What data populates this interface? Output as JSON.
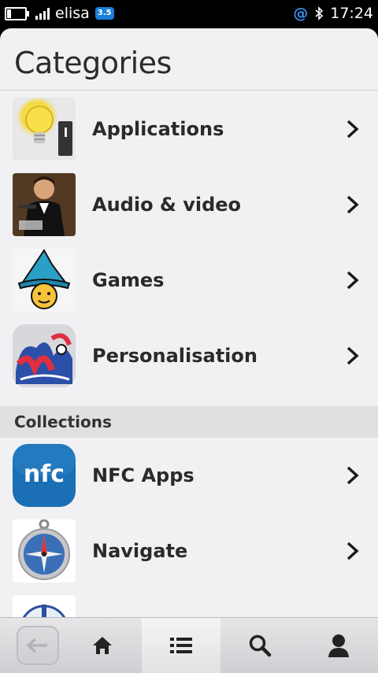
{
  "status_bar": {
    "carrier": "elisa",
    "network_badge": "3.5",
    "time": "17:24",
    "icons": [
      "battery-icon",
      "signal-icon",
      "at-icon",
      "bluetooth-icon"
    ]
  },
  "page": {
    "title": "Categories"
  },
  "categories": [
    {
      "label": "Applications",
      "icon": "lightbulb-icon"
    },
    {
      "label": "Audio & video",
      "icon": "movie-poster-icon"
    },
    {
      "label": "Games",
      "icon": "wizard-hat-icon"
    },
    {
      "label": "Personalisation",
      "icon": "graffiti-icon"
    }
  ],
  "collections": {
    "header": "Collections",
    "items": [
      {
        "label": "NFC Apps",
        "icon": "nfc-icon",
        "icon_text": "nfc"
      },
      {
        "label": "Navigate",
        "icon": "compass-icon"
      }
    ]
  },
  "toolbar": {
    "buttons": [
      "back-icon",
      "home-icon",
      "list-icon",
      "search-icon",
      "profile-icon"
    ],
    "active": "list-icon"
  },
  "colors": {
    "background": "#f1f1f3",
    "nfc_blue": "#1a6fb5",
    "accent": "#1a7fd9"
  }
}
